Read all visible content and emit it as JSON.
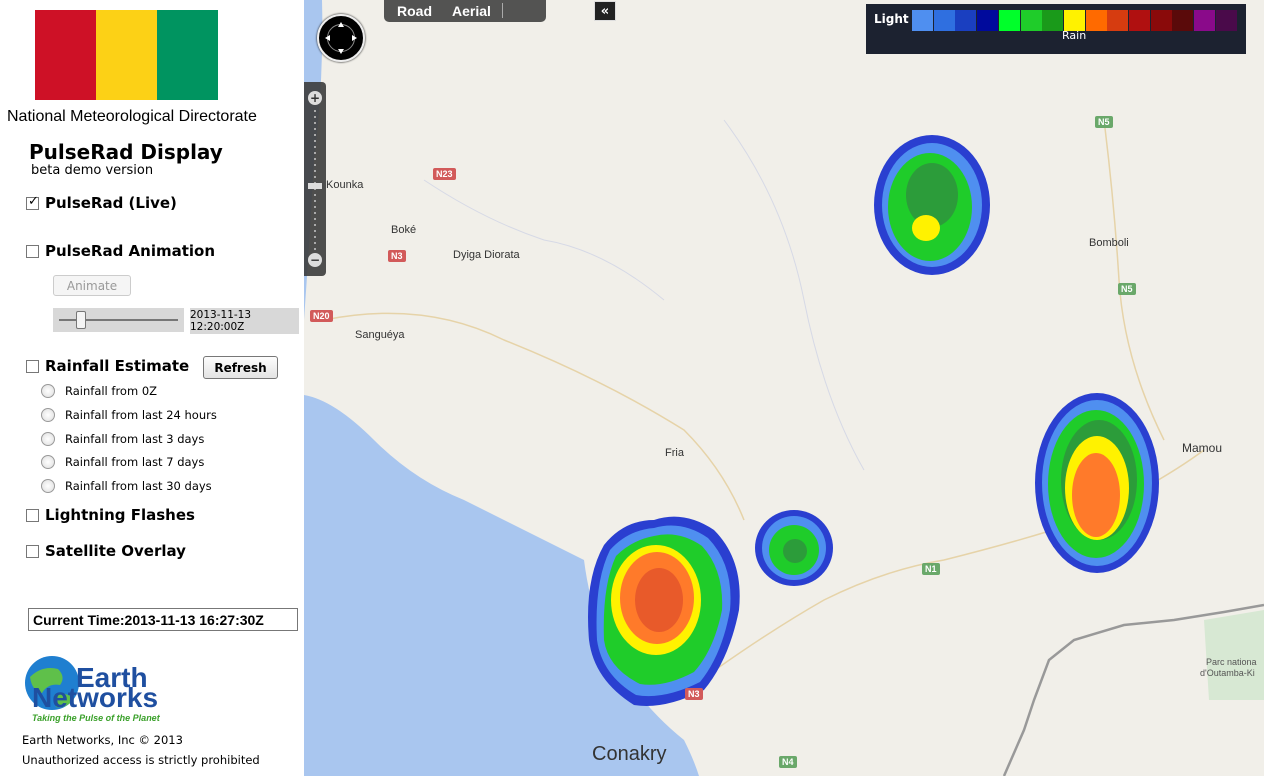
{
  "branding": {
    "org_name": "National Meteorological Directorate",
    "flag_colors": [
      "#ce1126",
      "#fcd116",
      "#009460"
    ]
  },
  "header": {
    "title": "PulseRad Display",
    "subtitle": "beta demo version"
  },
  "controls": {
    "live": {
      "label": "PulseRad (Live)",
      "checked": true
    },
    "animation": {
      "label": "PulseRad Animation",
      "checked": false,
      "button_label": "Animate",
      "timestamp": "2013-11-13 12:20:00Z",
      "slider_fraction": 0.16
    },
    "rainfall": {
      "label": "Rainfall Estimate",
      "checked": false,
      "refresh_label": "Refresh",
      "options": [
        "Rainfall from 0Z",
        "Rainfall from last 24 hours",
        "Rainfall from last 3 days",
        "Rainfall from last 7 days",
        "Rainfall from last 30 days"
      ]
    },
    "lightning": {
      "label": "Lightning Flashes",
      "checked": false
    },
    "satellite": {
      "label": "Satellite Overlay",
      "checked": false
    }
  },
  "current_time": "Current Time:2013-11-13 16:27:30Z",
  "footer": {
    "logo_line1": "Earth",
    "logo_line2": "Networks",
    "tagline": "Taking the Pulse of the Planet",
    "copyright": "Earth Networks, Inc © 2013",
    "notice": "Unauthorized access is strictly prohibited"
  },
  "map": {
    "map_types": [
      "Road",
      "Aerial"
    ],
    "collapse_icon": "double-chevron-left-icon",
    "legend": {
      "light_label": "Light",
      "rain_label": "Rain",
      "colors": [
        "#4f8ff0",
        "#2f6fe0",
        "#1a3fc0",
        "#000a9c",
        "#00ff2a",
        "#1fcc2a",
        "#1a9a1a",
        "#fff200",
        "#ff6a00",
        "#d63c10",
        "#b01010",
        "#8a0a0a",
        "#5a0a0a",
        "#8a0a8a",
        "#4a0a4a"
      ]
    },
    "places": {
      "kounka": "Kounka",
      "boke": "Boké",
      "dyiga": "Dyiga Diorata",
      "sangueya": "Sanguéya",
      "fria": "Fria",
      "bomboli": "Bomboli",
      "mamou": "Mamou",
      "conakry": "Conakry",
      "parc1": "Parc nationa",
      "parc2": "d'Outamba-Ki"
    },
    "roads": {
      "n23": "N23",
      "n3a": "N3",
      "n20": "N20",
      "n5a": "N5",
      "n5b": "N5",
      "n1": "N1",
      "n3b": "N3",
      "n4": "N4"
    }
  }
}
